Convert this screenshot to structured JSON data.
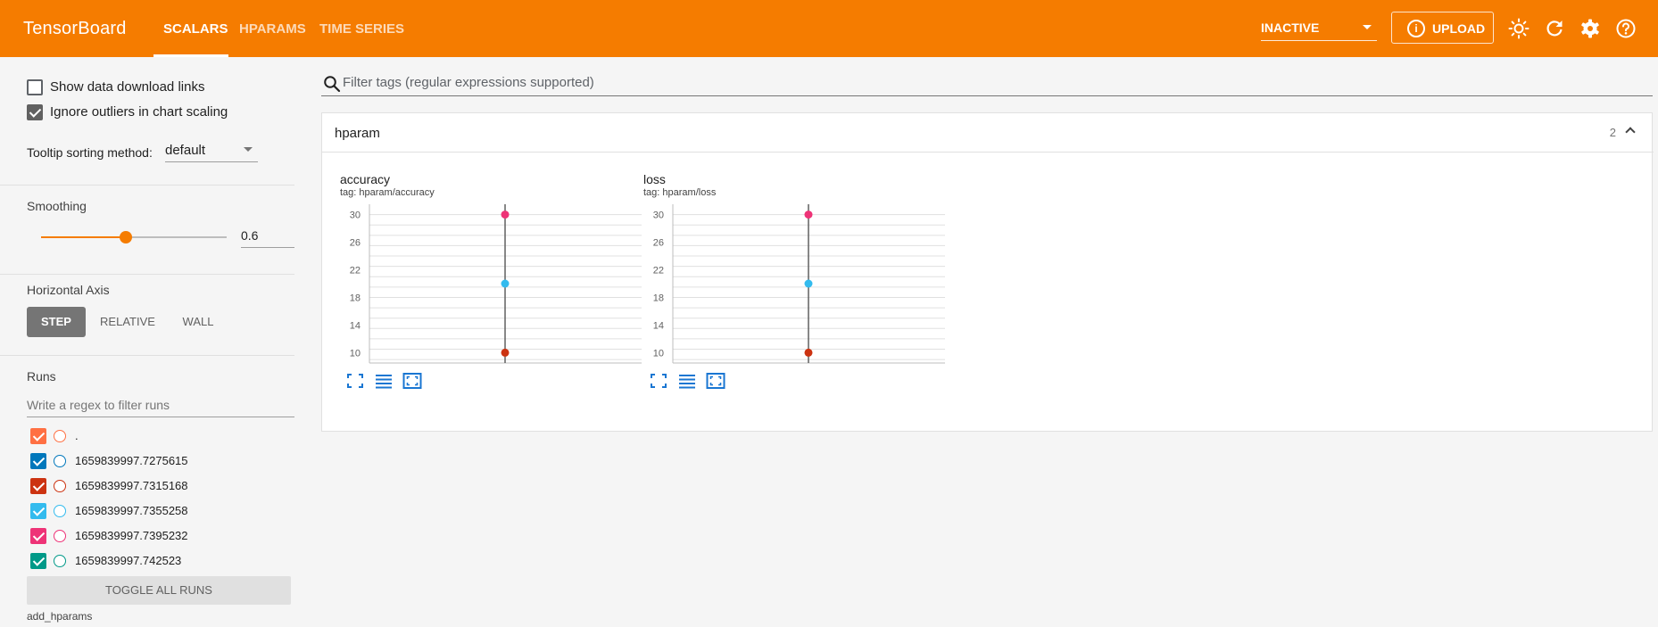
{
  "app": {
    "brand": "TensorBoard",
    "tabs": [
      {
        "label": "SCALARS",
        "active": true
      },
      {
        "label": "HPARAMS",
        "active": false
      },
      {
        "label": "TIME SERIES",
        "active": false
      }
    ],
    "status_select": "INACTIVE",
    "upload_label": "UPLOAD",
    "accent_color": "#f57c00"
  },
  "sidebar": {
    "show_download_links": {
      "label": "Show data download links",
      "checked": false
    },
    "ignore_outliers": {
      "label": "Ignore outliers in chart scaling",
      "checked": true
    },
    "tooltip_sorting": {
      "label": "Tooltip sorting method:",
      "value": "default"
    },
    "smoothing": {
      "heading": "Smoothing",
      "value": "0.6",
      "level": 0.6
    },
    "horizontal_axis": {
      "heading": "Horizontal Axis",
      "options": [
        "STEP",
        "RELATIVE",
        "WALL"
      ],
      "selected": "STEP"
    },
    "runs": {
      "heading": "Runs",
      "filter_placeholder": "Write a regex to filter runs",
      "items": [
        {
          "name": ".",
          "color": "#ff7043",
          "checked": true
        },
        {
          "name": "1659839997.7275615",
          "color": "#0077bb",
          "checked": true
        },
        {
          "name": "1659839997.7315168",
          "color": "#cc3311",
          "checked": true
        },
        {
          "name": "1659839997.7355258",
          "color": "#33bbee",
          "checked": true
        },
        {
          "name": "1659839997.7395232",
          "color": "#ee3377",
          "checked": true
        },
        {
          "name": "1659839997.742523",
          "color": "#009988",
          "checked": true
        }
      ],
      "toggle_label": "TOGGLE ALL RUNS",
      "footer": "add_hparams"
    }
  },
  "main": {
    "filter_placeholder": "Filter tags (regular expressions supported)",
    "group": {
      "title": "hparam",
      "count": "2"
    }
  },
  "chart_data": [
    {
      "type": "scatter",
      "title": "accuracy",
      "subtitle": "tag: hparam/accuracy",
      "x_ticks": [
        "0"
      ],
      "y_ticks": [
        "10",
        "14",
        "18",
        "22",
        "26",
        "30"
      ],
      "ylim": [
        8.5,
        31.5
      ],
      "series": [
        {
          "color": "#ee3377",
          "x": [
            0
          ],
          "y": [
            30
          ]
        },
        {
          "color": "#33bbee",
          "x": [
            0
          ],
          "y": [
            20
          ]
        },
        {
          "color": "#cc3311",
          "x": [
            0
          ],
          "y": [
            10
          ]
        }
      ]
    },
    {
      "type": "scatter",
      "title": "loss",
      "subtitle": "tag: hparam/loss",
      "x_ticks": [
        "0"
      ],
      "y_ticks": [
        "10",
        "14",
        "18",
        "22",
        "26",
        "30"
      ],
      "ylim": [
        8.5,
        31.5
      ],
      "series": [
        {
          "color": "#ee3377",
          "x": [
            0
          ],
          "y": [
            30
          ]
        },
        {
          "color": "#33bbee",
          "x": [
            0
          ],
          "y": [
            20
          ]
        },
        {
          "color": "#cc3311",
          "x": [
            0
          ],
          "y": [
            10
          ]
        }
      ]
    }
  ]
}
